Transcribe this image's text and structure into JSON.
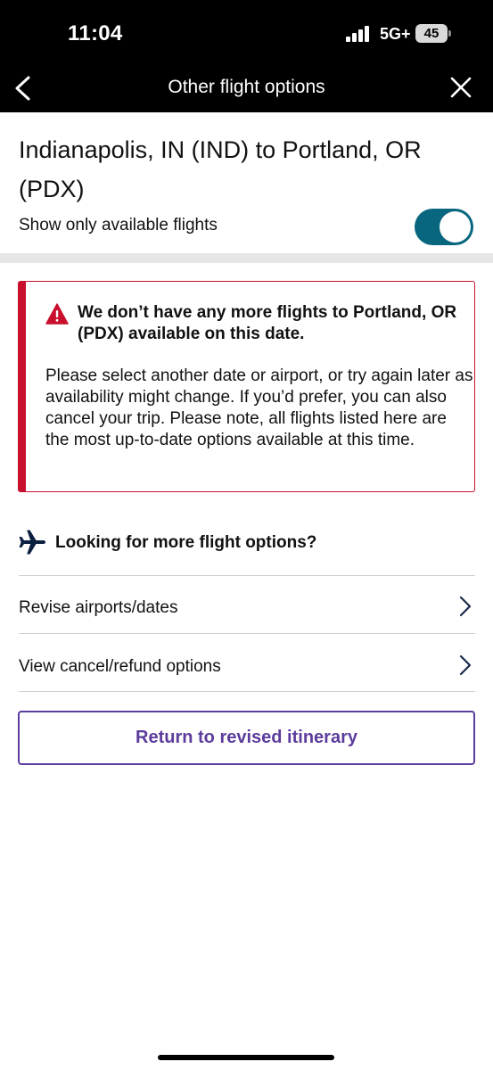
{
  "status_bar": {
    "time": "11:04",
    "network": "5G+",
    "battery": "45",
    "icons": [
      "signal-bars-icon",
      "battery-icon"
    ]
  },
  "header": {
    "title": "Other flight options",
    "back_icon": "chevron-left-icon",
    "close_icon": "close-icon"
  },
  "route": {
    "title": "Indianapolis, IN (IND) to Portland, OR (PDX)"
  },
  "filter": {
    "label": "Show only available flights",
    "enabled": true,
    "toggle_color": "#08677f"
  },
  "alert": {
    "icon": "warning-triangle-icon",
    "color": "#c8102e",
    "heading": "We don’t have any more flights to Portland, OR (PDX) available on this date.",
    "body": "Please select another date or airport, or try again later as availability might change. If you’d prefer, you can also cancel your trip. Please note, all flights listed here are the most up-to-date options available at this time."
  },
  "more_options": {
    "icon": "airplane-icon",
    "label": "Looking for more flight options?",
    "items": [
      {
        "label": "Revise airports/dates",
        "icon": "chevron-right-icon"
      },
      {
        "label": "View cancel/refund options",
        "icon": "chevron-right-icon"
      }
    ]
  },
  "primary_action": {
    "label": "Return to revised itinerary",
    "color": "#5c3c9c"
  }
}
